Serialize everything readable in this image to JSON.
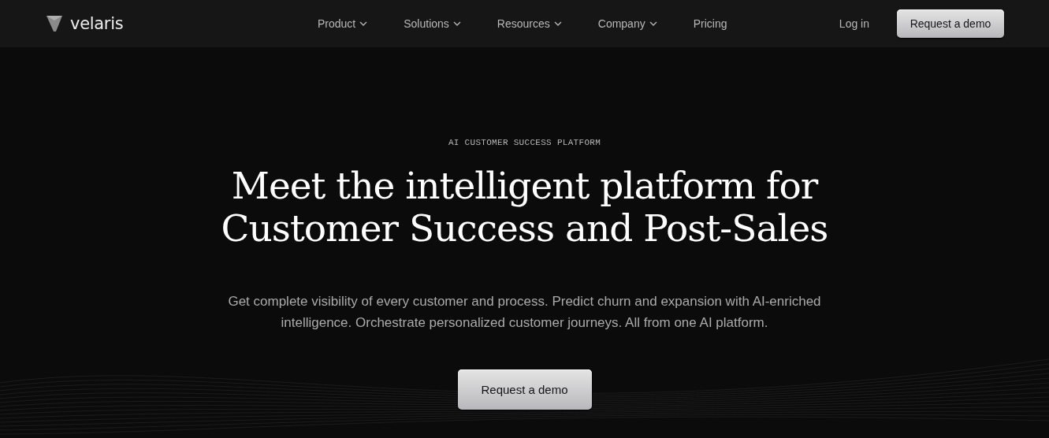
{
  "header": {
    "logo": "velaris",
    "nav": [
      {
        "label": "Product",
        "kind": "dropdown"
      },
      {
        "label": "Solutions",
        "kind": "dropdown"
      },
      {
        "label": "Resources",
        "kind": "dropdown"
      },
      {
        "label": "Company",
        "kind": "dropdown"
      },
      {
        "label": "Pricing",
        "kind": "link"
      }
    ],
    "login": "Log in",
    "cta": "Request a demo"
  },
  "hero": {
    "eyebrow": "AI CUSTOMER SUCCESS PLATFORM",
    "headline_lines": [
      "Meet the intelligent platform for",
      "Customer Success and Post-Sales"
    ],
    "description_lines": [
      "Get complete visibility of every customer and process. Predict churn and expansion with AI-enriched",
      "intelligence. Orchestrate personalized customer journeys. All from one AI platform."
    ],
    "cta": "Request a demo"
  }
}
